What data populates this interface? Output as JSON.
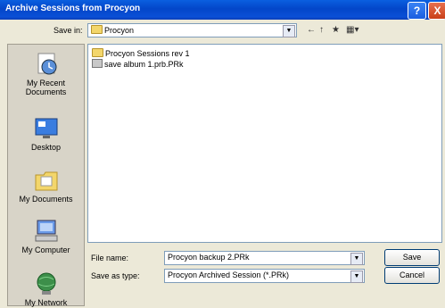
{
  "window": {
    "title": "Archive Sessions from Procyon",
    "help": "?",
    "close": "X"
  },
  "savein": {
    "label": "Save in:",
    "value": "Procyon"
  },
  "toolbar": {
    "back": "←",
    "up": "↑",
    "newfolder": "★",
    "views": "▦▾"
  },
  "sidebar": {
    "recent_line1": "My Recent",
    "recent_line2": "Documents",
    "desktop": "Desktop",
    "mydocs": "My Documents",
    "mycomputer": "My Computer",
    "mynetwork": "My Network"
  },
  "files": [
    {
      "name": "Procyon Sessions rev 1",
      "type": "folder"
    },
    {
      "name": "save album 1.prb.PRk",
      "type": "file"
    }
  ],
  "filename": {
    "label": "File name:",
    "value": "Procyon backup 2.PRk"
  },
  "filetype": {
    "label": "Save as type:",
    "value": "Procyon Archived Session (*.PRk)"
  },
  "buttons": {
    "save": "Save",
    "cancel": "Cancel"
  }
}
